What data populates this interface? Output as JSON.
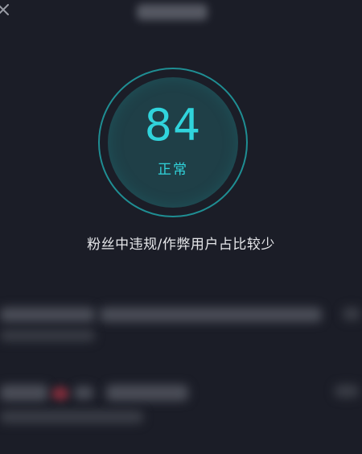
{
  "header": {
    "back_icon": "close-icon"
  },
  "score_panel": {
    "score": "84",
    "status": "正常",
    "accent_color": "#30d4dc"
  },
  "description": "粉丝中违规/作弊用户占比较少"
}
